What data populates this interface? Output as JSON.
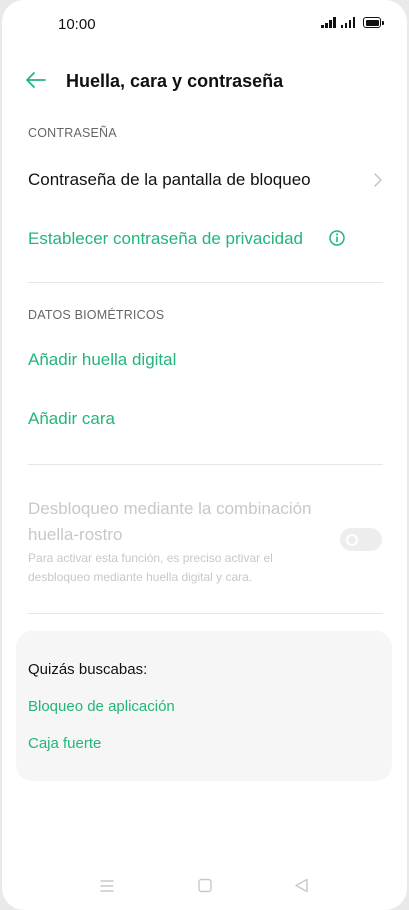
{
  "status_bar": {
    "time": "10:00"
  },
  "header": {
    "title": "Huella, cara y contraseña"
  },
  "sections": {
    "password": {
      "label": "CONTRASEÑA",
      "lock_screen_password": "Contraseña de la pantalla de bloqueo",
      "privacy_password": "Establecer contraseña de privacidad"
    },
    "biometrics": {
      "label": "DATOS BIOMÉTRICOS",
      "add_fingerprint": "Añadir huella digital",
      "add_face": "Añadir cara"
    },
    "combo_unlock": {
      "title": "Desbloqueo mediante la combinación huella-rostro",
      "description": "Para activar esta función, es preciso activar el desbloqueo mediante huella digital y cara.",
      "enabled": false
    }
  },
  "suggestions": {
    "title": "Quizás buscabas:",
    "links": [
      "Bloqueo de aplicación",
      "Caja fuerte"
    ]
  },
  "colors": {
    "accent": "#23b57a",
    "disabled_text": "#c8c8c8"
  },
  "icons": {
    "back": "arrow-left-icon",
    "chevron": "chevron-right-icon",
    "info": "info-circle-icon",
    "nav_menu": "menu-icon",
    "nav_home": "square-icon",
    "nav_back": "triangle-back-icon"
  }
}
